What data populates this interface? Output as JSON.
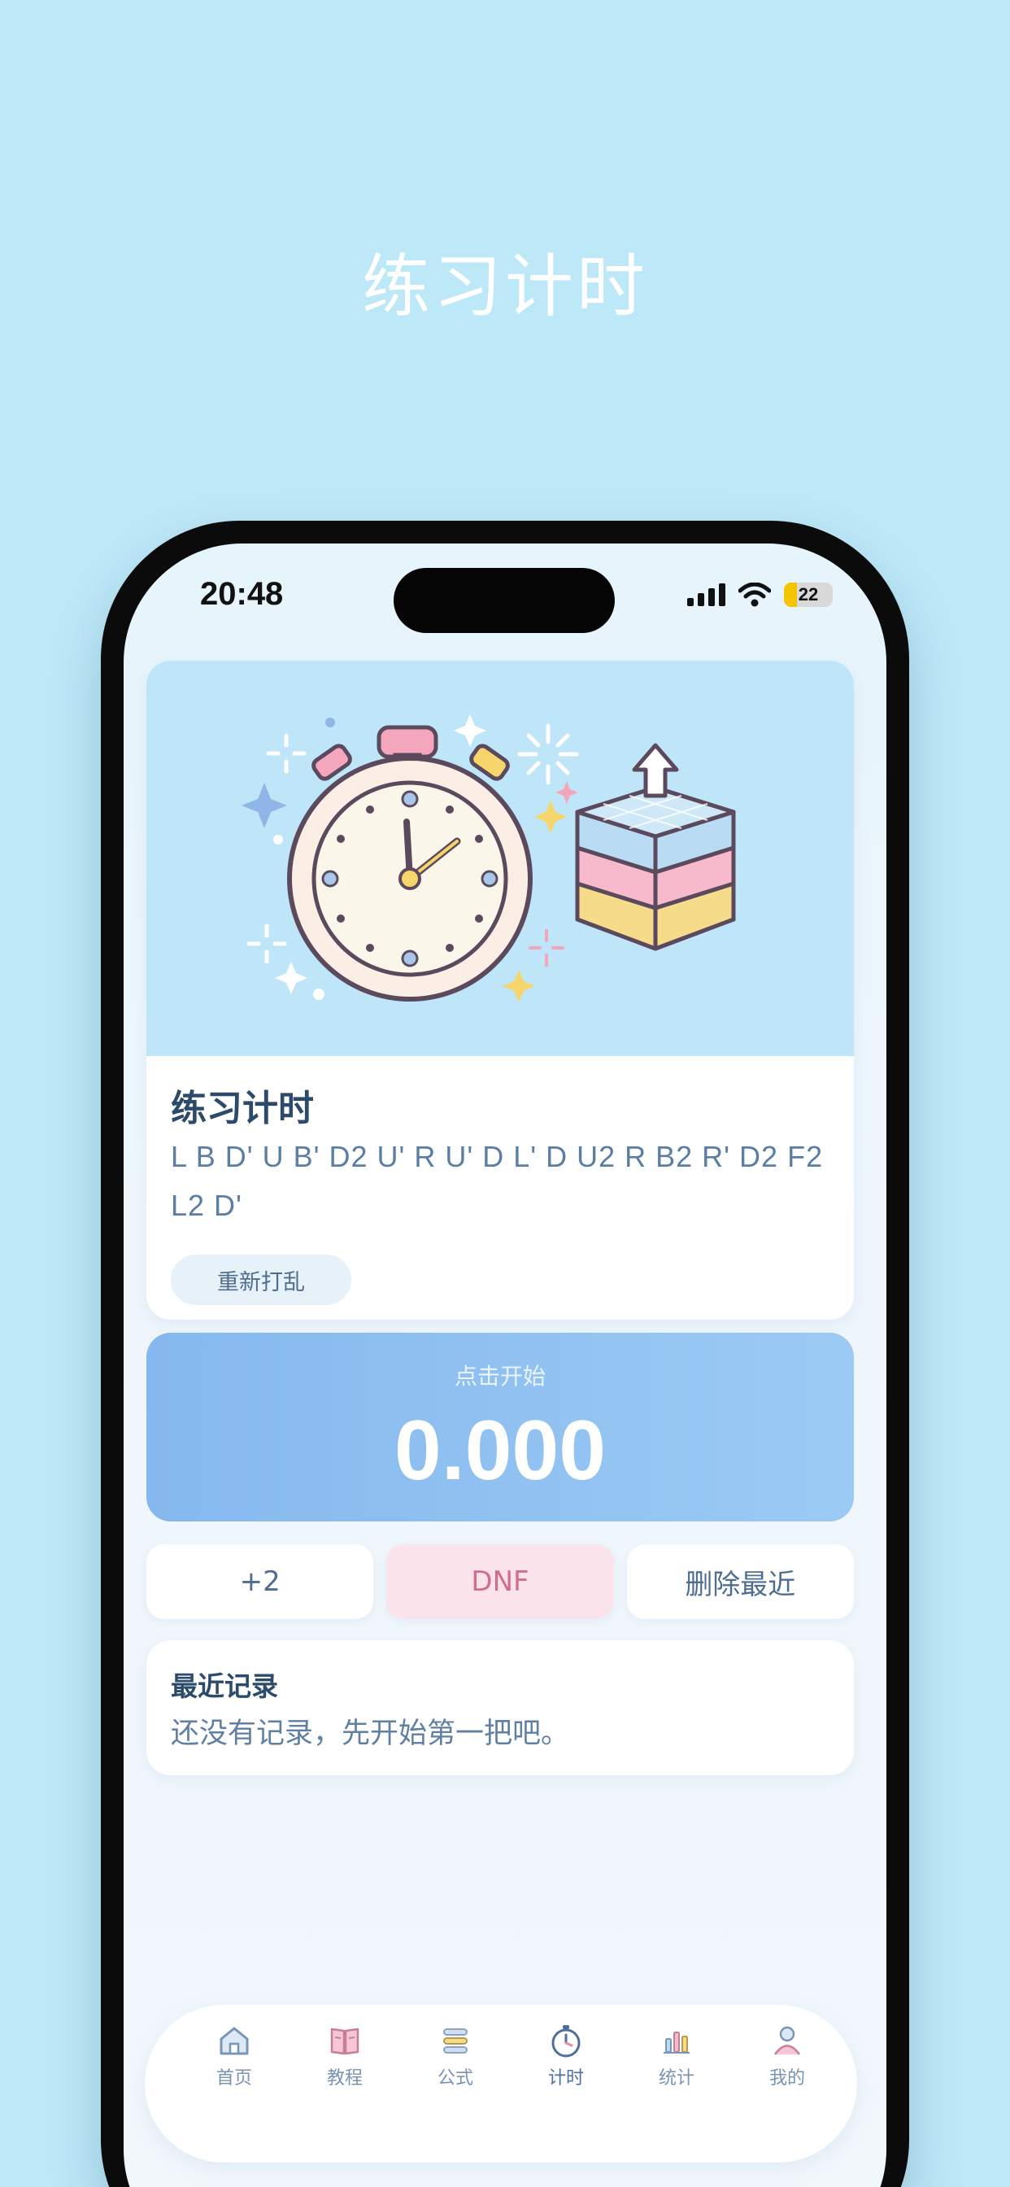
{
  "headline": "练习计时",
  "status_bar": {
    "time": "20:48",
    "battery": "22"
  },
  "hero": {
    "title": "练习计时",
    "scramble": "L B D' U B' D2 U' R U' D L' D U2 R B2 R' D2 F2 L2 D'",
    "rescramble_label": "重新打乱"
  },
  "timer": {
    "hint": "点击开始",
    "value": "0.000"
  },
  "actions": {
    "plus2": "+2",
    "dnf": "DNF",
    "delete_last": "删除最近"
  },
  "recent": {
    "title": "最近记录",
    "empty_text": "还没有记录，先开始第一把吧。"
  },
  "tabs": [
    {
      "label": "首页",
      "icon": "home-icon"
    },
    {
      "label": "教程",
      "icon": "book-icon"
    },
    {
      "label": "公式",
      "icon": "formula-icon"
    },
    {
      "label": "计时",
      "icon": "stopwatch-icon"
    },
    {
      "label": "统计",
      "icon": "chart-icon"
    },
    {
      "label": "我的",
      "icon": "profile-icon"
    }
  ],
  "active_tab": "计时",
  "colors": {
    "background": "#bde8f8",
    "accent_blue": "#85b8ee",
    "dnf_pink": "#fbe3ec",
    "title_navy": "#2c4a6b"
  }
}
